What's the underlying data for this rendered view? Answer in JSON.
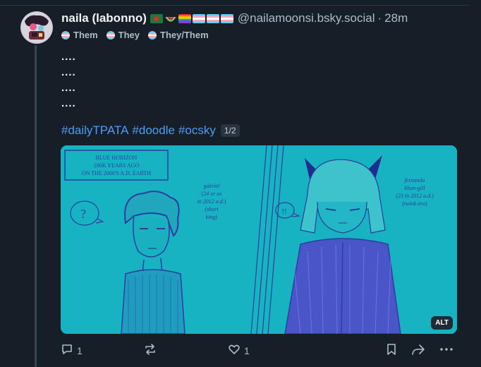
{
  "author": {
    "display_name": "naila (labonno)",
    "handle": "@nailamoonsi.bsky.social",
    "separator": "·",
    "time": "28m",
    "flag_icons": [
      "bangladesh-flag-icon",
      "watermelon-icon",
      "rainbow-flag-icon",
      "trans-flag-icon",
      "trans-flag-icon",
      "trans-flag-icon"
    ]
  },
  "pronouns": [
    "Them",
    "They",
    "They/Them"
  ],
  "post": {
    "lines": [
      "....",
      "....",
      "....",
      "...."
    ],
    "hashtags": [
      "#dailyTPATA",
      "#doodle",
      "#ocsky"
    ],
    "image_counter": "1/2"
  },
  "image": {
    "alt_badge": "ALT",
    "caption_box": [
      "BLUE HORIZON",
      "100K YEARS AGO",
      "ON THE 2000'S A.D. EARTH"
    ],
    "label_left": [
      "gabriel",
      "(24 or so",
      "in 2012 a.d.)",
      "(short",
      "king)"
    ],
    "label_right": [
      "fernando",
      "khan-gill",
      "(23 in 2012 a.d.)",
      "(twink era)"
    ],
    "bubble_left": "?",
    "bubble_right": "!!",
    "background_color": "#17b3c2",
    "ink_color": "#2a3f9e"
  },
  "actions": {
    "replies": "1",
    "likes": "1"
  },
  "colors": {
    "background": "#161e27",
    "link": "#4f9cf5",
    "muted": "#aebbc9"
  }
}
